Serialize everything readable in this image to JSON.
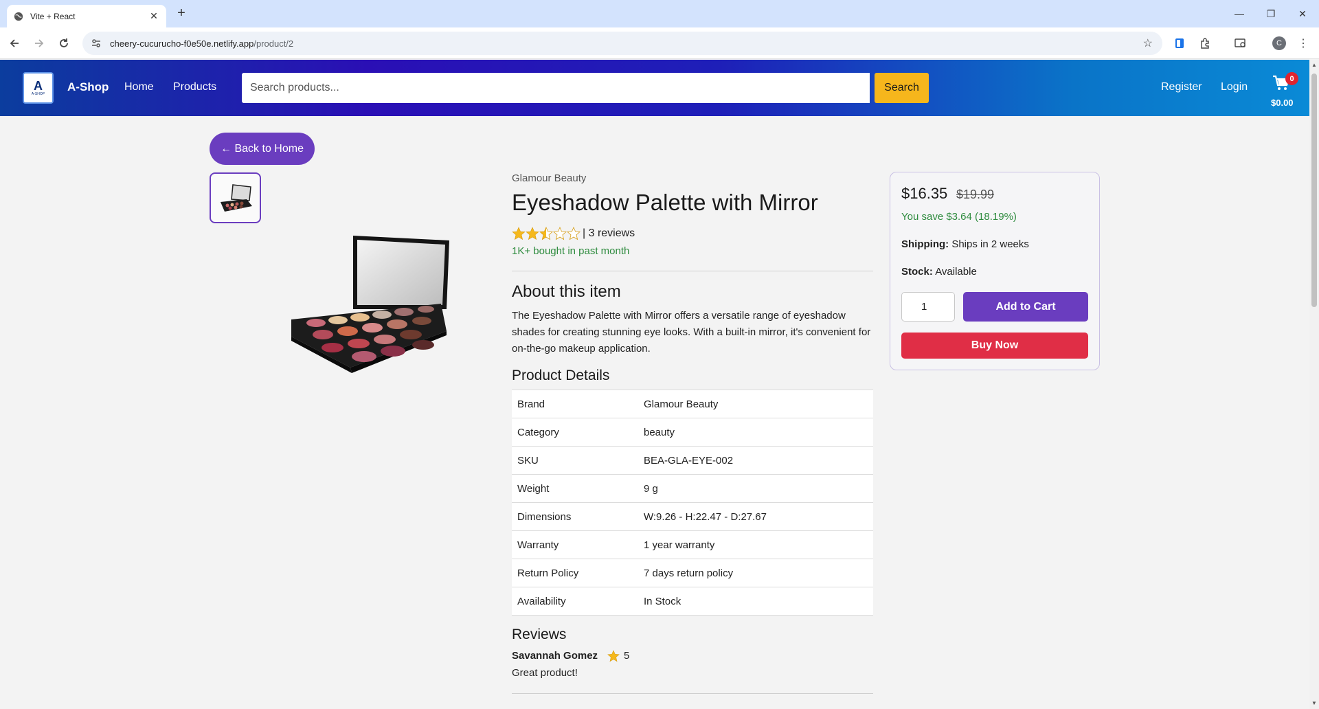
{
  "browser": {
    "tab_title": "Vite + React",
    "url_host": "cheery-cucurucho-f0e50e.netlify.app",
    "url_path": "/product/2",
    "profile_initial": "C"
  },
  "header": {
    "brand": "A-Shop",
    "logo_letter": "A",
    "logo_sub": "A-SHOP",
    "nav": [
      "Home",
      "Products"
    ],
    "search_placeholder": "Search products...",
    "search_button": "Search",
    "register": "Register",
    "login": "Login",
    "cart_count": "0",
    "cart_total": "$0.00"
  },
  "page": {
    "back_label": "← Back to Home",
    "brand_name": "Glamour Beauty",
    "title": "Eyeshadow Palette with Mirror",
    "rating": 2.5,
    "reviews_count": "| 3 reviews",
    "bought": "1K+ bought in past month",
    "about_title": "About this item",
    "about_text": "The Eyeshadow Palette with Mirror offers a versatile range of eyeshadow shades for creating stunning eye looks. With a built-in mirror, it's convenient for on-the-go makeup application.",
    "details_title": "Product Details",
    "details": [
      {
        "key": "Brand",
        "value": "Glamour Beauty"
      },
      {
        "key": "Category",
        "value": "beauty"
      },
      {
        "key": "SKU",
        "value": "BEA-GLA-EYE-002"
      },
      {
        "key": "Weight",
        "value": "9 g"
      },
      {
        "key": "Dimensions",
        "value": "W:9.26 - H:22.47 - D:27.67"
      },
      {
        "key": "Warranty",
        "value": "1 year warranty"
      },
      {
        "key": "Return Policy",
        "value": "7 days return policy"
      },
      {
        "key": "Availability",
        "value": "In Stock"
      }
    ],
    "reviews_title": "Reviews",
    "reviews": [
      {
        "author": "Savannah Gomez",
        "rating": "5",
        "text": "Great product!"
      }
    ]
  },
  "buybox": {
    "price": "$16.35",
    "old_price": "$19.99",
    "save": "You save $3.64 (18.19%)",
    "shipping_label": "Shipping:",
    "shipping_value": "Ships in 2 weeks",
    "stock_label": "Stock:",
    "stock_value": "Available",
    "quantity": "1",
    "add_to_cart": "Add to Cart",
    "buy_now": "Buy Now"
  },
  "colors": {
    "accent": "#6a3dbf",
    "search_button": "#f6b61c",
    "buy_now": "#e02e46",
    "success": "#2e8b3e",
    "star": "#f5b81c"
  }
}
